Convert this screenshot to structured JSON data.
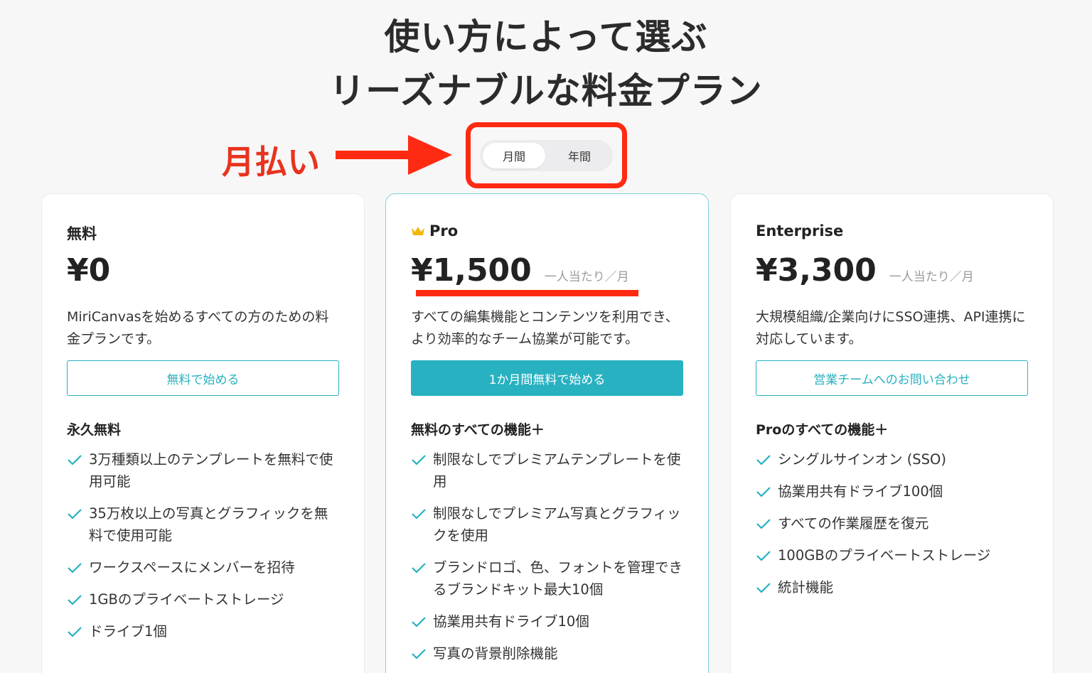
{
  "heading": {
    "line1": "使い方によって選ぶ",
    "line2": "リーズナブルな料金プラン"
  },
  "annotation": {
    "label": "月払い",
    "color": "#e8331e"
  },
  "billing_toggle": {
    "options": [
      "月間",
      "年間"
    ],
    "selected": "月間"
  },
  "colors": {
    "accent": "#27b1c1",
    "highlight": "#ff2a12"
  },
  "plans": [
    {
      "name": "無料",
      "price": "¥0",
      "per": "",
      "description": "MiriCanvasを始めるすべての方のための料金プランです。",
      "cta": "無料で始める",
      "features_heading": "永久無料",
      "features": [
        "3万種類以上のテンプレートを無料で使用可能",
        "35万枚以上の写真とグラフィックを無料で使用可能",
        "ワークスペースにメンバーを招待",
        "1GBのプライベートストレージ",
        "ドライブ1個"
      ]
    },
    {
      "name": "Pro",
      "icon": "crown-icon",
      "price": "¥1,500",
      "per": "一人当たり／月",
      "description": "すべての編集機能とコンテンツを利用でき、より効率的なチーム協業が可能です。",
      "cta": "1か月間無料で始める",
      "features_heading": "無料のすべての機能＋",
      "features": [
        "制限なしでプレミアムテンプレートを使用",
        "制限なしでプレミアム写真とグラフィックを使用",
        "ブランドロゴ、色、フォントを管理できるブランドキット最大10個",
        "協業用共有ドライブ10個",
        "写真の背景削除機能"
      ]
    },
    {
      "name": "Enterprise",
      "price": "¥3,300",
      "per": "一人当たり／月",
      "description": "大規模組織/企業向けにSSO連携、API連携に対応しています。",
      "cta": "営業チームへのお問い合わせ",
      "features_heading": "Proのすべての機能＋",
      "features": [
        "シングルサインオン (SSO)",
        "協業用共有ドライブ100個",
        "すべての作業履歴を復元",
        "100GBのプライベートストレージ",
        "統計機能"
      ]
    }
  ]
}
